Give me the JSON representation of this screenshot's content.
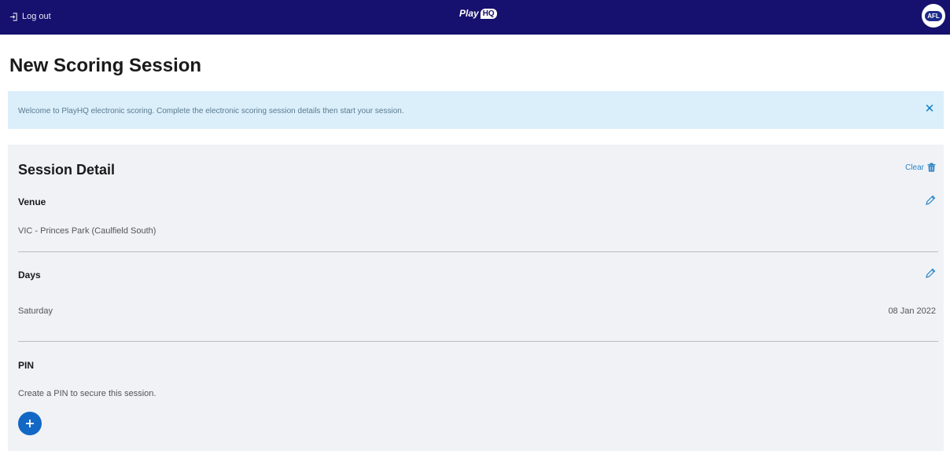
{
  "header": {
    "logout_label": "Log out",
    "brand_main": "Play",
    "brand_badge": "HQ",
    "org_badge": "AFL",
    "bg_color": "#16106e"
  },
  "page": {
    "title": "New Scoring Session"
  },
  "banner": {
    "message": "Welcome to PlayHQ electronic scoring. Complete the electronic scoring session details then start your session.",
    "close_icon": "close-icon",
    "bg_color": "#dbeffb"
  },
  "session": {
    "title": "Session Detail",
    "clear_label": "Clear",
    "venue": {
      "label": "Venue",
      "value": "VIC - Princes Park (Caulfield South)"
    },
    "days": {
      "label": "Days",
      "day": "Saturday",
      "date": "08 Jan 2022"
    },
    "pin": {
      "label": "PIN",
      "hint": "Create a PIN to secure this session."
    }
  },
  "accent_color": "#1268c4"
}
